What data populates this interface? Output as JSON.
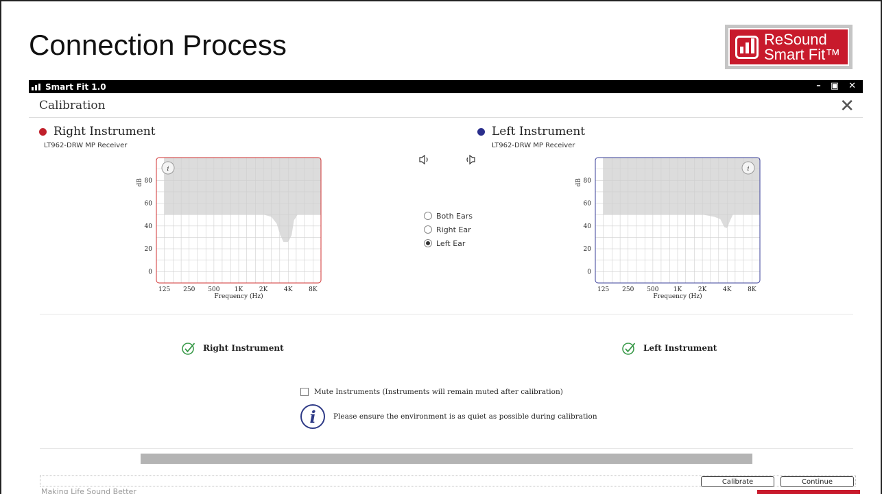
{
  "slide": {
    "title": "Connection Process"
  },
  "logo": {
    "line1": "ReSound",
    "line2": "Smart Fit™",
    "color": "#c81a2c"
  },
  "app": {
    "name": "Smart Fit 1.0",
    "minimize": "–",
    "restore": "▣",
    "close": "✕"
  },
  "calibration": {
    "title": "Calibration",
    "close": "✕"
  },
  "right_instrument": {
    "name": "Right Instrument",
    "model": "LT962-DRW  MP Receiver",
    "color": "#c0202b",
    "status": "Right Instrument"
  },
  "left_instrument": {
    "name": "Left Instrument",
    "model": "LT962-DRW  MP Receiver",
    "color": "#2a2e8c",
    "status": "Left Instrument"
  },
  "ear_select": {
    "options": [
      "Both Ears",
      "Right Ear",
      "Left Ear"
    ],
    "selected": "Left Ear"
  },
  "sound_icons": [
    "speaker-right-icon",
    "speaker-left-icon"
  ],
  "chart_data": [
    {
      "type": "area",
      "name": "right",
      "y_unit_label": "dB",
      "y_ticks": [
        80,
        60,
        40,
        20,
        0
      ],
      "ylim": [
        -10,
        100
      ],
      "x_ticks": [
        "125",
        "250",
        "500",
        "1K",
        "2K",
        "4K",
        "8K"
      ],
      "xlabel": "Frequency (Hz)",
      "grid": true,
      "border_color": "#d03030",
      "noise_floor": {
        "x": [
          125,
          250,
          500,
          1000,
          2000,
          2500,
          2900,
          3200,
          3500,
          4000,
          4400,
          4700,
          5200,
          8000,
          10000
        ],
        "y": [
          50,
          50,
          50,
          50,
          50,
          48,
          42,
          32,
          26,
          26,
          32,
          45,
          50,
          50,
          50
        ]
      }
    },
    {
      "type": "area",
      "name": "left",
      "y_unit_label": "dB",
      "y_ticks": [
        80,
        60,
        40,
        20,
        0
      ],
      "ylim": [
        -10,
        100
      ],
      "x_ticks": [
        "125",
        "250",
        "500",
        "1K",
        "2K",
        "4K",
        "8K"
      ],
      "xlabel": "Frequency (Hz)",
      "grid": true,
      "border_color": "#3a3f9a",
      "noise_floor": {
        "x": [
          125,
          250,
          500,
          1000,
          2000,
          2800,
          3300,
          3700,
          4000,
          4300,
          4700,
          8000,
          10000
        ],
        "y": [
          50,
          50,
          50,
          50,
          50,
          48,
          46,
          39,
          38,
          44,
          50,
          50,
          50
        ]
      }
    }
  ],
  "mute": {
    "label": "Mute Instruments (Instruments will remain muted after calibration)",
    "checked": false
  },
  "info": {
    "glyph": "i",
    "text": "Please ensure the environment is as quiet as possible during calibration"
  },
  "progress": {
    "fraction": 1.0
  },
  "buttons": {
    "calibrate": "Calibrate",
    "continue": "Continue"
  },
  "footer": {
    "text": "Making Life Sound Better"
  }
}
